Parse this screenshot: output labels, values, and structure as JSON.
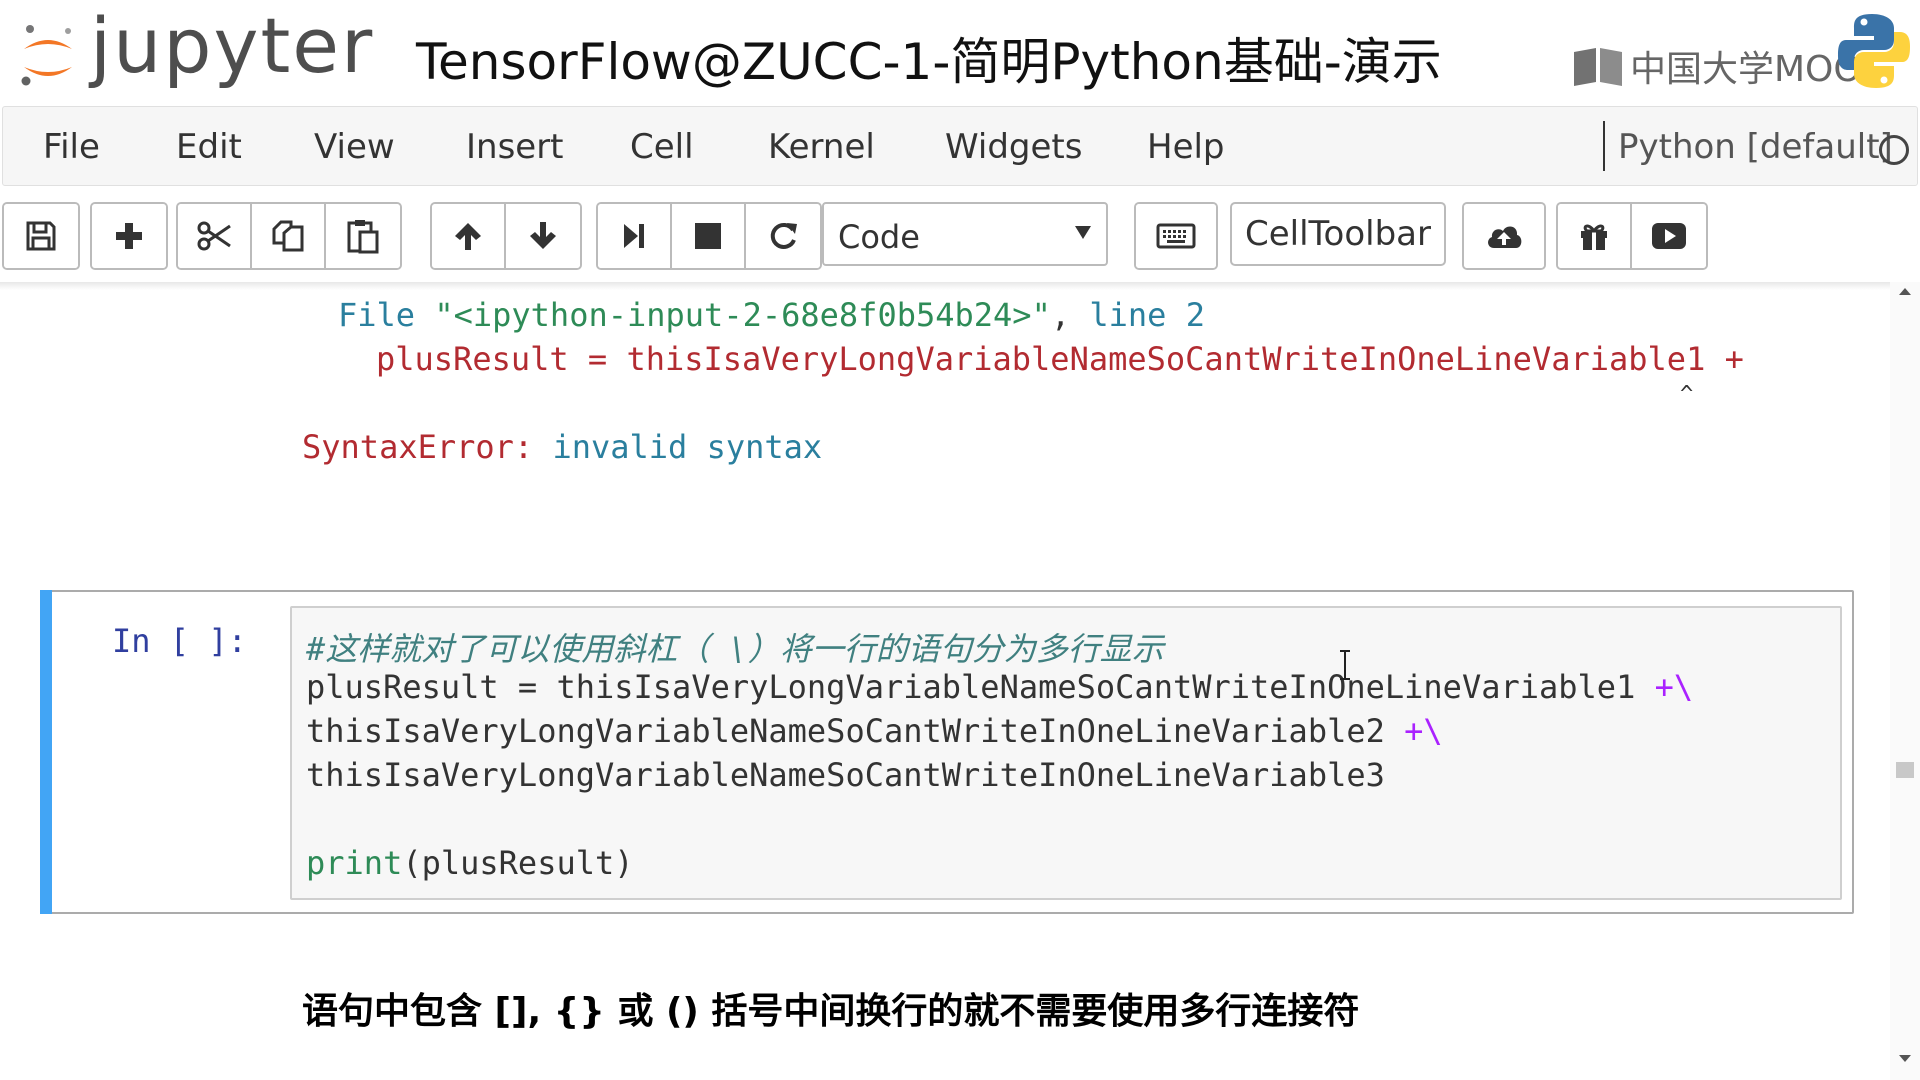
{
  "header": {
    "logo_text": "jupyter",
    "notebook_title": "TensorFlow@ZUCC-1-简明Python基础-演示",
    "watermark_text": "中国大学MOOC"
  },
  "menubar": {
    "items": [
      "File",
      "Edit",
      "View",
      "Insert",
      "Cell",
      "Kernel",
      "Widgets",
      "Help"
    ],
    "kernel_name": "Python [default]"
  },
  "toolbar": {
    "cell_type": "Code",
    "celltoolbar_label": "CellToolbar",
    "icons": [
      "save-icon",
      "plus-icon",
      "cut-icon",
      "copy-icon",
      "paste-icon",
      "arrow-up-icon",
      "arrow-down-icon",
      "step-forward-icon",
      "stop-icon",
      "refresh-icon",
      "chevron-down-icon",
      "keyboard-icon",
      "cloud-upload-icon",
      "gift-icon",
      "play-icon"
    ]
  },
  "error_output": {
    "file_prefix": "File ",
    "file_name": "\"<ipython-input-2-68e8f0b54b24>\"",
    "line_sep": ", ",
    "line_label": "line 2",
    "code_line": "plusResult = thisIsaVeryLongVariableNameSoCantWriteInOneLineVariable1 +",
    "caret": "^",
    "error_type": "SyntaxError:",
    "error_message": " invalid syntax"
  },
  "cell": {
    "prompt": "In [ ]:",
    "comment": "#这样就对了可以使用斜杠（ \\）将一行的语句分为多行显示",
    "line1": "plusResult = thisIsaVeryLongVariableNameSoCantWriteInOneLineVariable1 ",
    "line1_op": "+\\",
    "line2": "thisIsaVeryLongVariableNameSoCantWriteInOneLineVariable2 ",
    "line2_op": "+\\",
    "line3": "thisIsaVeryLongVariableNameSoCantWriteInOneLineVariable3",
    "print_kw": "print",
    "print_args": "(plusResult)"
  },
  "markdown": {
    "text": "语句中包含 [], {} 或 () 括号中间换行的就不需要使用多行连接符"
  },
  "colors": {
    "cell_selected_bar": "#42a5f5",
    "prompt_in": "#303f9f",
    "error_red": "#b22b31",
    "comment": "#408080",
    "jupyter_orange": "#f37726"
  }
}
